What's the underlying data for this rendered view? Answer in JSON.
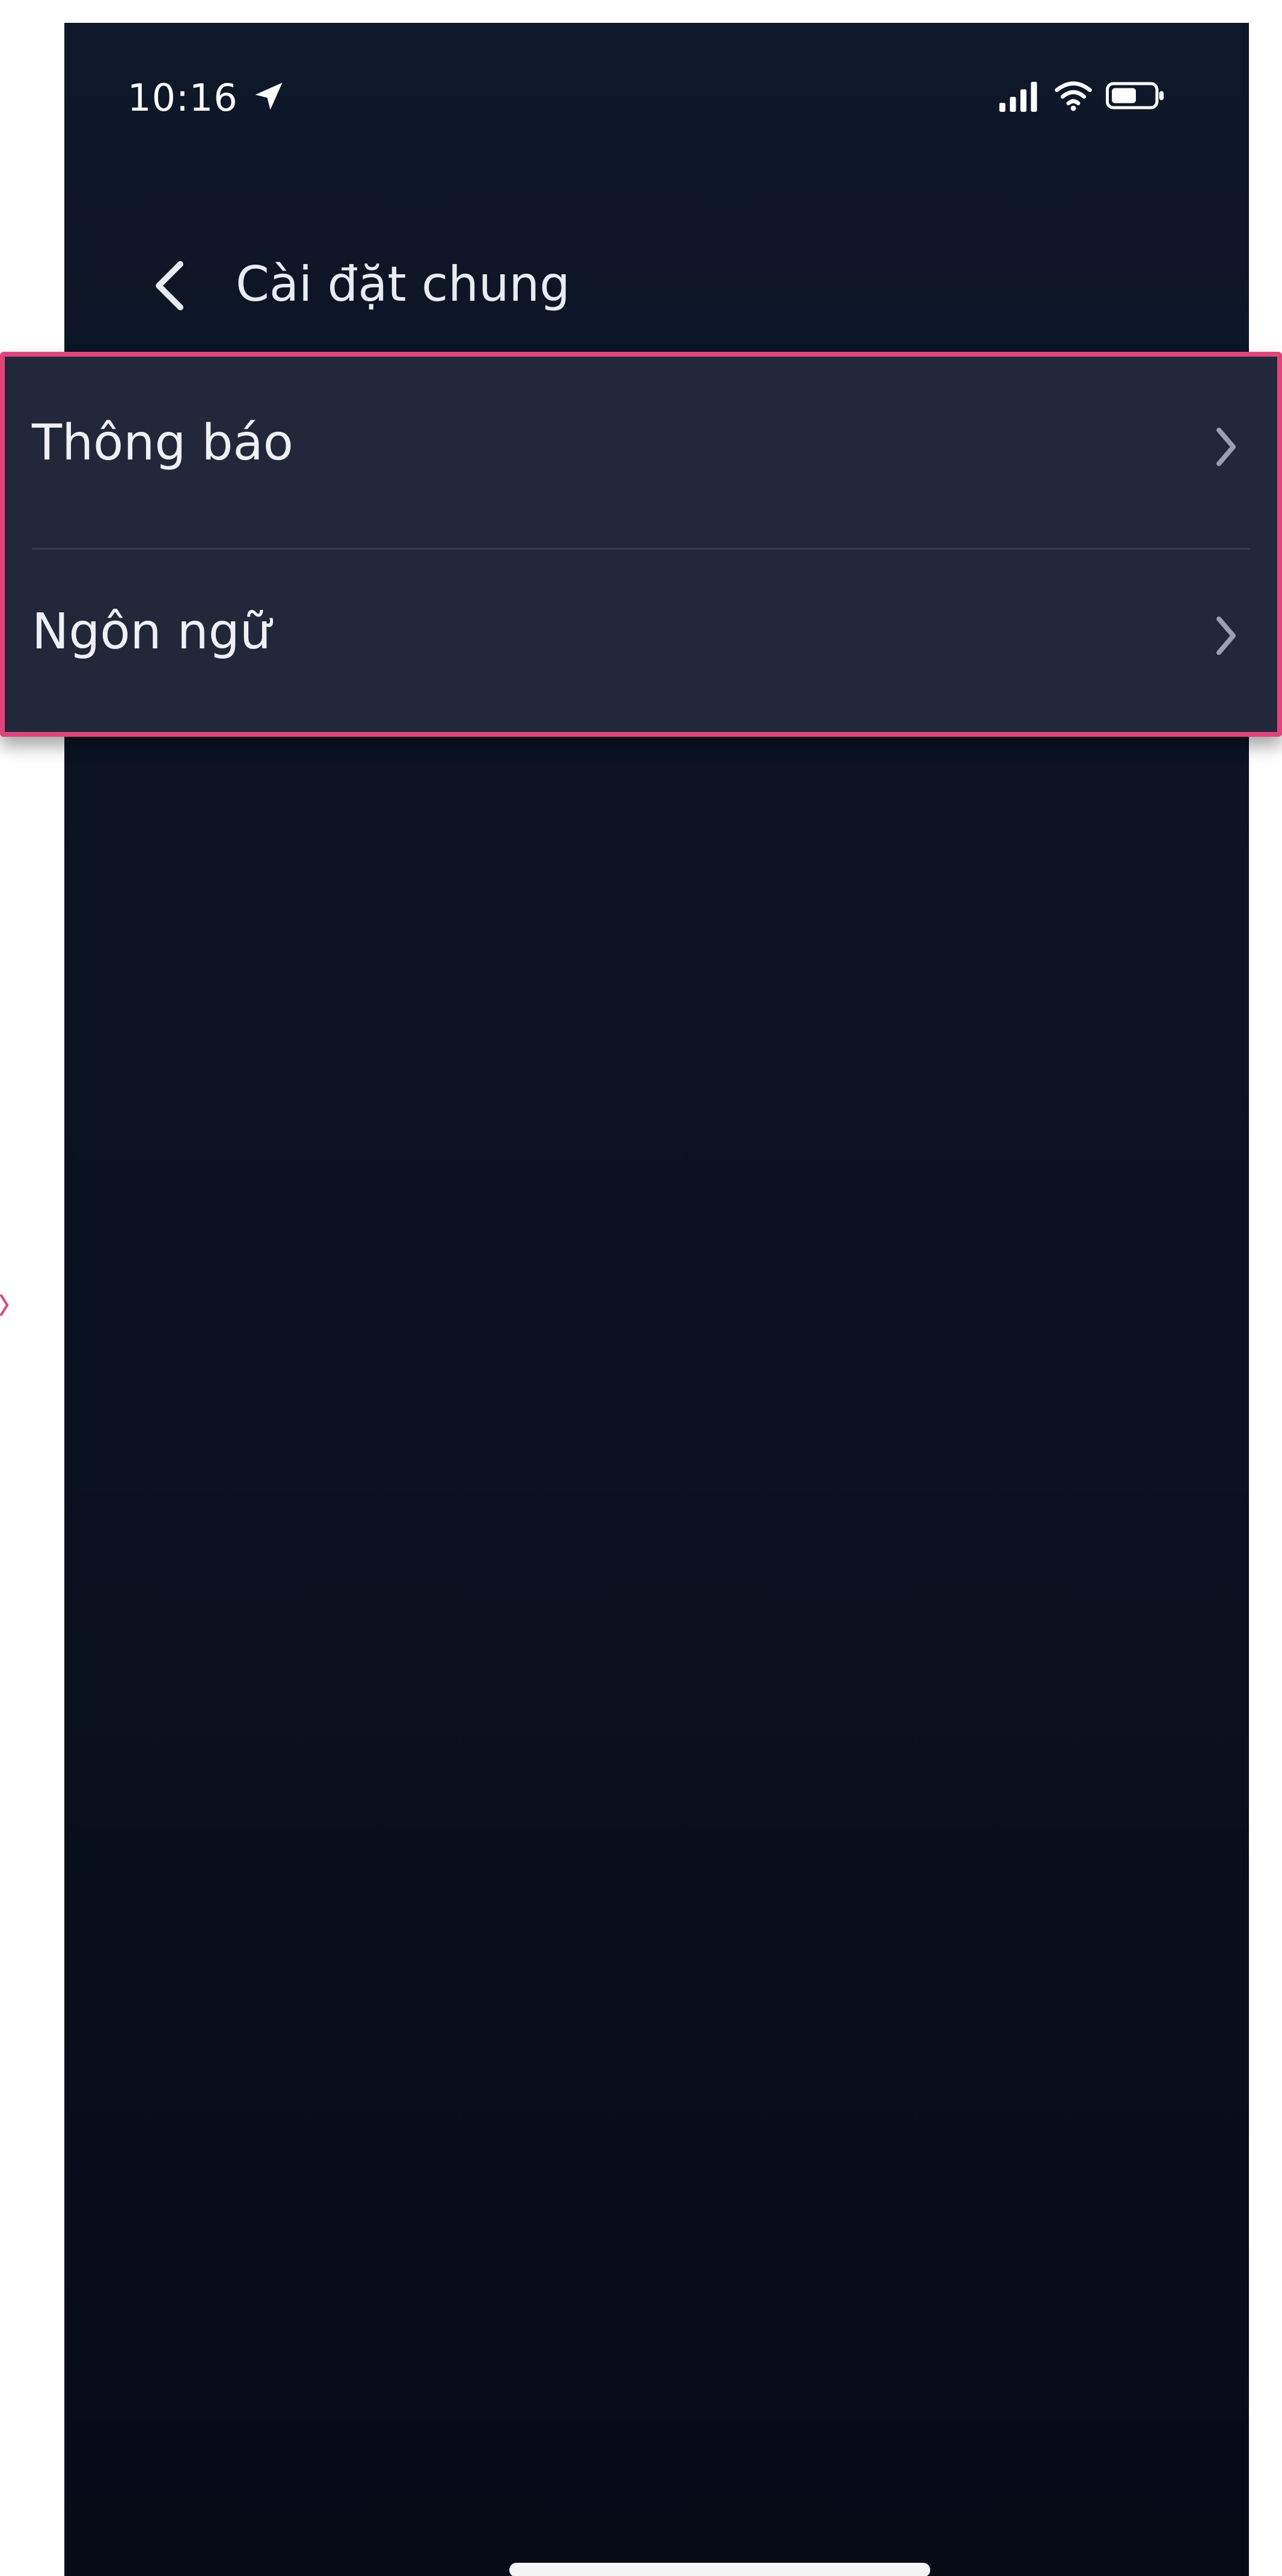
{
  "status_bar": {
    "time": "10:16",
    "icons": [
      "location-arrow-icon",
      "cellular-signal-icon",
      "wifi-icon",
      "battery-icon"
    ]
  },
  "nav": {
    "back_icon": "chevron-left-icon",
    "title": "Cài đặt chung"
  },
  "menu": {
    "items": [
      {
        "label": "Thông báo",
        "icon": "chevron-right-icon"
      },
      {
        "label": "Ngôn ngữ",
        "icon": "chevron-right-icon"
      }
    ]
  },
  "colors": {
    "background_top": "#0f1829",
    "background_bottom": "#060b16",
    "card": "#22283a",
    "highlight_border": "#e0447a",
    "text": "#eef0f4"
  }
}
